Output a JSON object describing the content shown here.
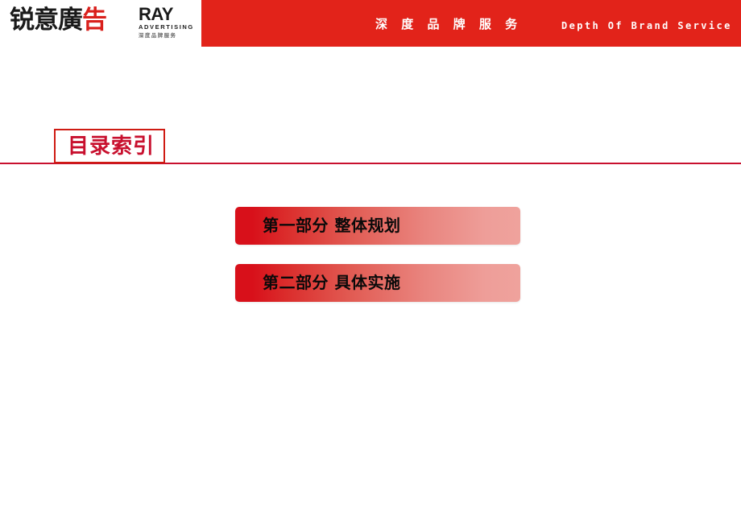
{
  "slide": {
    "background_color": "#ffffff",
    "accent_color": "#c8102e",
    "band_color": "#e2231a"
  },
  "header": {
    "logo": {
      "company_cn_main": "锐意廣",
      "company_cn_accent": "告",
      "brand_latin": "RAY",
      "brand_sub": "ADVERTISING",
      "brand_tagline_cn": "深度品牌服务"
    },
    "slogan_cn": "深 度 品 牌 服 务",
    "slogan_en": "Depth Of Brand Service"
  },
  "section": {
    "title": "目录索引"
  },
  "contents": {
    "items": [
      {
        "number": "第一部分",
        "label": "整体规划",
        "text": "第一部分    整体规划"
      },
      {
        "number": "第二部分",
        "label": "具体实施",
        "text": "第二部分    具体实施"
      }
    ]
  }
}
